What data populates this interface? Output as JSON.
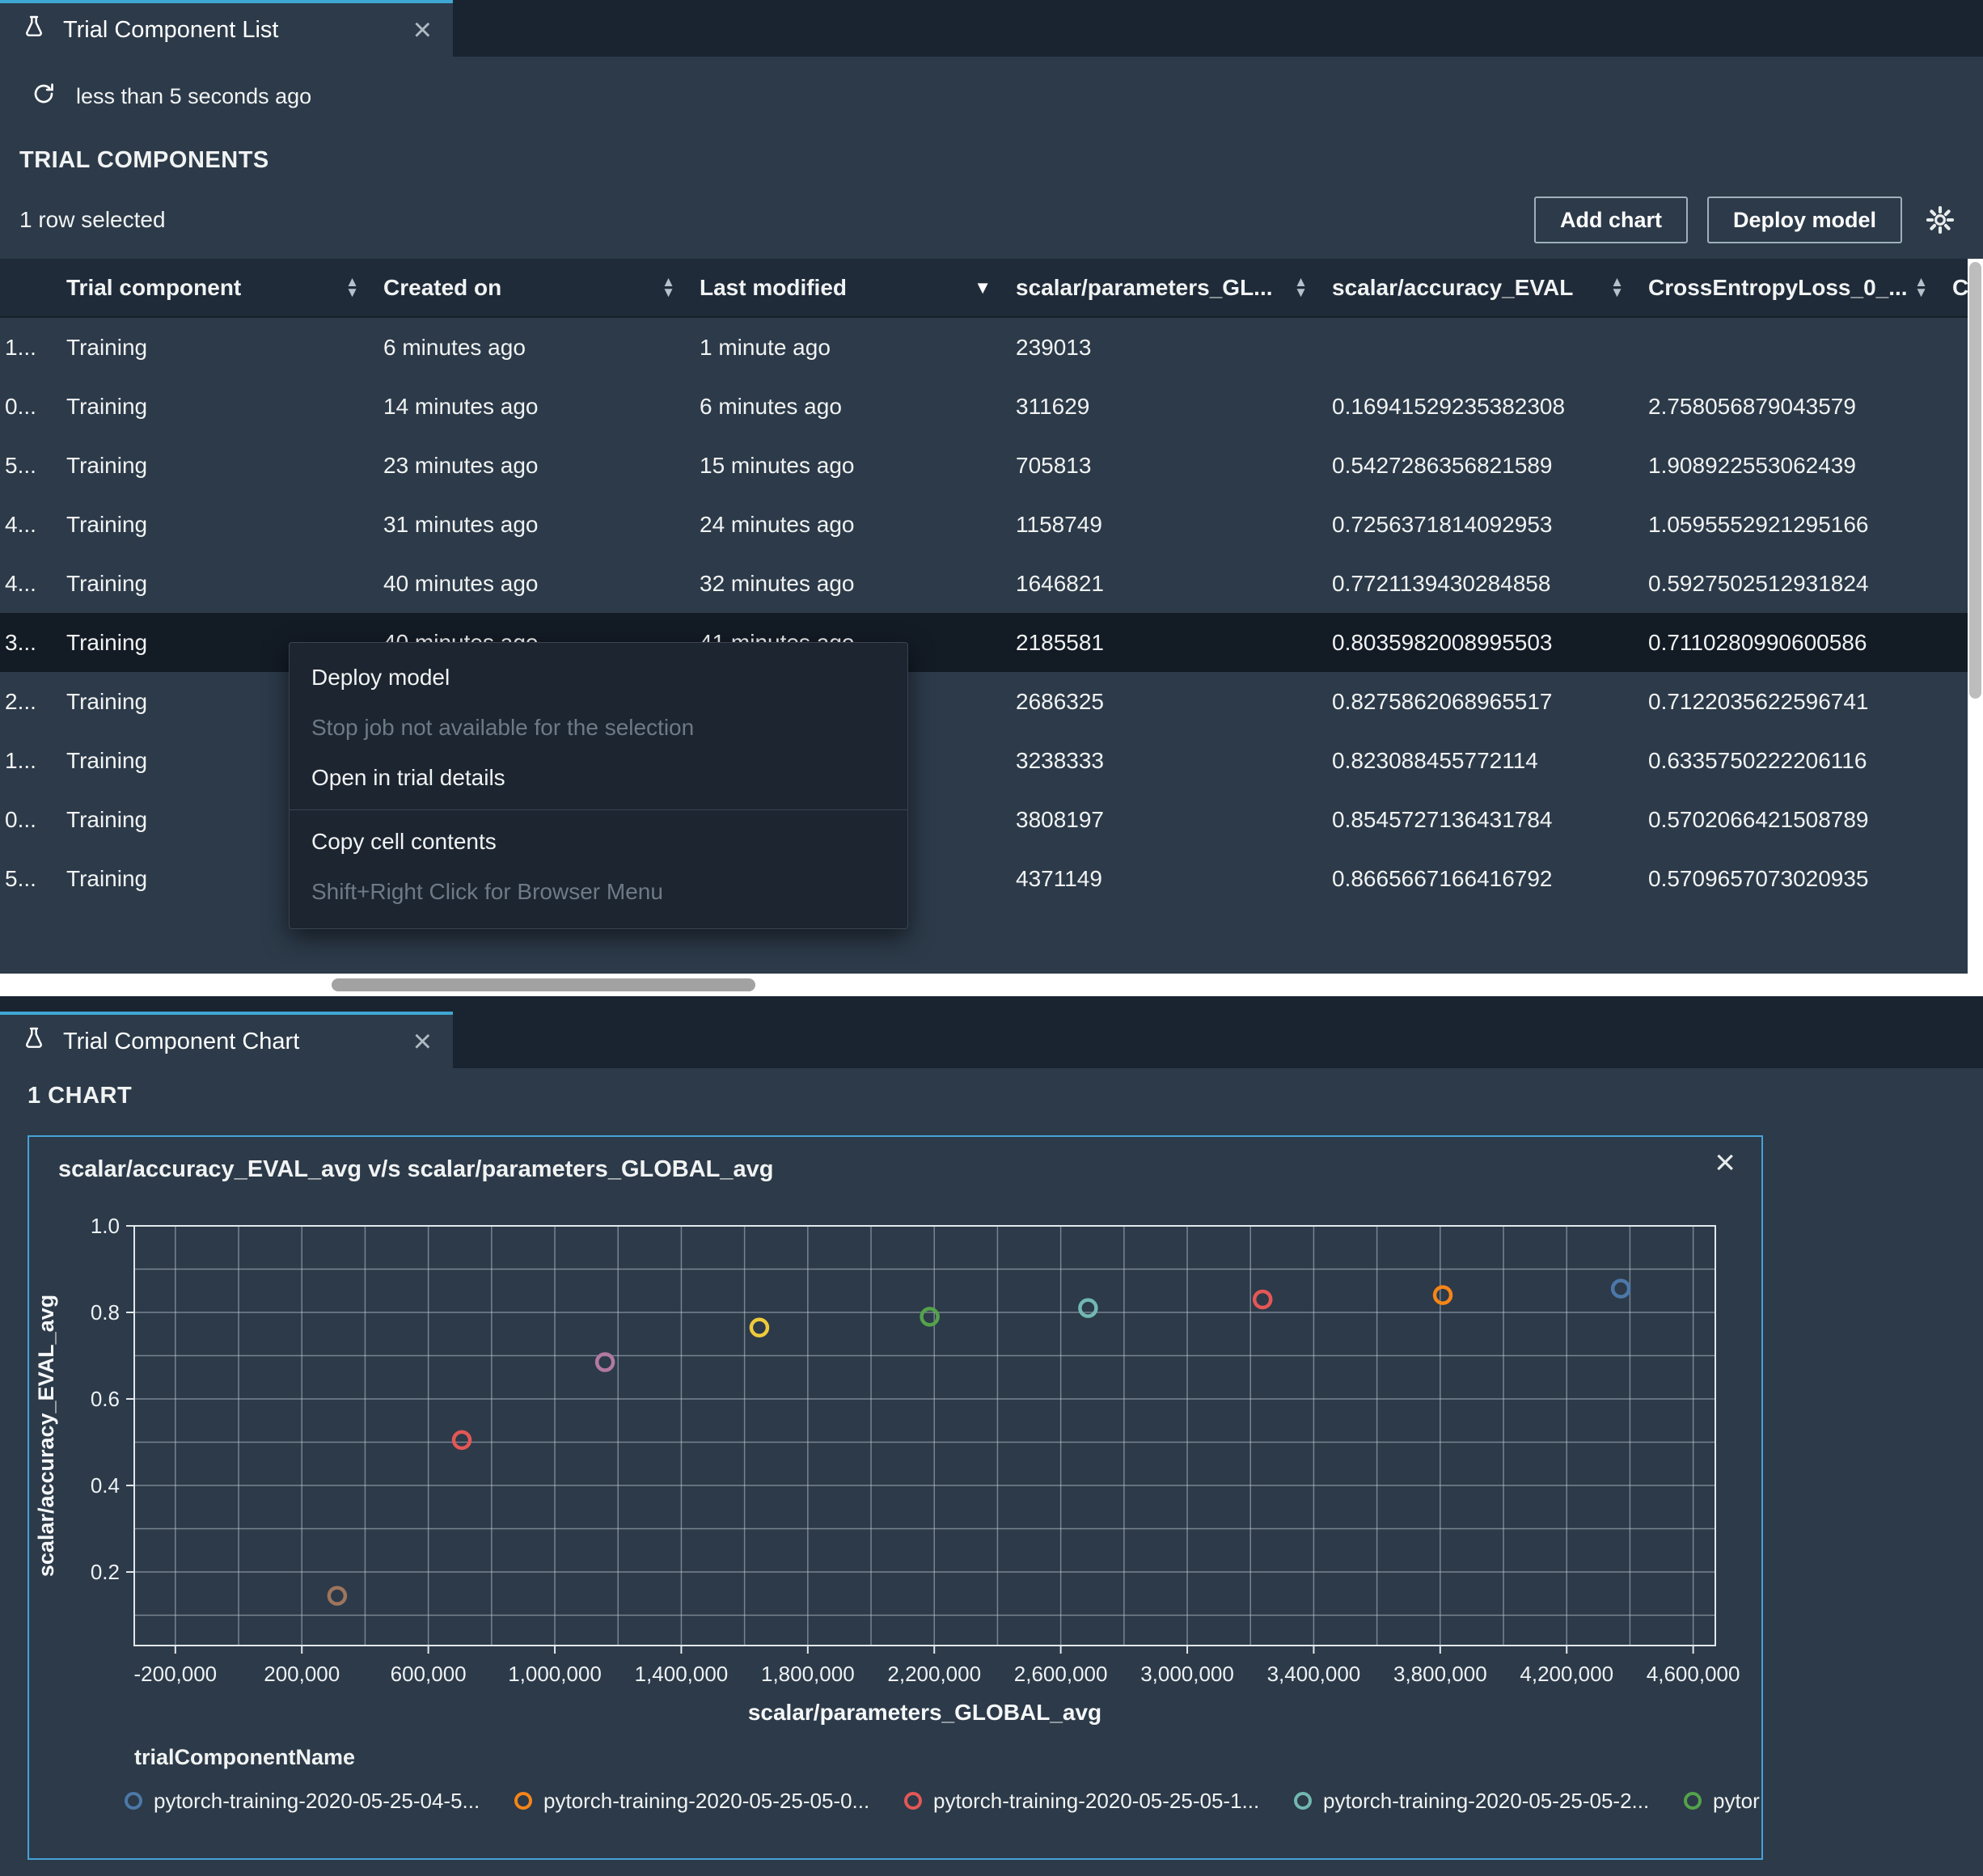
{
  "icons": {
    "close": "×",
    "sort_asc": "▲",
    "sort_desc": "▼"
  },
  "colors": {
    "accent": "#3fa7d4",
    "panel_bg": "#2c3a49",
    "chart_border": "#46a2d8",
    "selected_row": "#131b25"
  },
  "list_panel": {
    "tab_title": "Trial Component List",
    "refresh_text": "less than 5 seconds ago",
    "section_title": "TRIAL COMPONENTS",
    "selection_text": "1 row selected",
    "add_chart_label": "Add chart",
    "deploy_model_label": "Deploy model",
    "table": {
      "columns": [
        {
          "label": "",
          "sort": "none"
        },
        {
          "label": "Trial component",
          "sort": "both"
        },
        {
          "label": "Created on",
          "sort": "both"
        },
        {
          "label": "Last modified",
          "sort": "desc"
        },
        {
          "label": "scalar/parameters_GL...",
          "sort": "both"
        },
        {
          "label": "scalar/accuracy_EVAL",
          "sort": "both"
        },
        {
          "label": "CrossEntropyLoss_0_...",
          "sort": "both"
        },
        {
          "label": "C",
          "sort": "none"
        }
      ],
      "rows": [
        {
          "cells": [
            "1...",
            "Training",
            "6 minutes ago",
            "1 minute ago",
            "239013",
            "",
            "",
            ""
          ],
          "selected": false
        },
        {
          "cells": [
            "0...",
            "Training",
            "14 minutes ago",
            "6 minutes ago",
            "311629",
            "0.16941529235382308",
            "2.758056879043579",
            ""
          ],
          "selected": false
        },
        {
          "cells": [
            "5...",
            "Training",
            "23 minutes ago",
            "15 minutes ago",
            "705813",
            "0.5427286356821589",
            "1.908922553062439",
            ""
          ],
          "selected": false
        },
        {
          "cells": [
            "4...",
            "Training",
            "31 minutes ago",
            "24 minutes ago",
            "1158749",
            "0.7256371814092953",
            "1.0595552921295166",
            ""
          ],
          "selected": false
        },
        {
          "cells": [
            "4...",
            "Training",
            "40 minutes ago",
            "32 minutes ago",
            "1646821",
            "0.7721139430284858",
            "0.5927502512931824",
            ""
          ],
          "selected": false
        },
        {
          "cells": [
            "3...",
            "Training",
            "40 minutes ago",
            "41 minutes ago",
            "2185581",
            "0.8035982008995503",
            "0.7110280990600586",
            ""
          ],
          "selected": true
        },
        {
          "cells": [
            "2...",
            "Training",
            "",
            "",
            "2686325",
            "0.8275862068965517",
            "0.7122035622596741",
            ""
          ],
          "selected": false
        },
        {
          "cells": [
            "1...",
            "Training",
            "",
            "",
            "3238333",
            "0.823088455772114",
            "0.6335750222206116",
            ""
          ],
          "selected": false
        },
        {
          "cells": [
            "0...",
            "Training",
            "",
            "",
            "3808197",
            "0.8545727136431784",
            "0.5702066421508789",
            ""
          ],
          "selected": false
        },
        {
          "cells": [
            "5...",
            "Training",
            "",
            "",
            "4371149",
            "0.8665667166416792",
            "0.5709657073020935",
            ""
          ],
          "selected": false
        }
      ]
    },
    "context_menu": {
      "items": [
        {
          "label": "Deploy model",
          "disabled": false
        },
        {
          "label": "Stop job not available for the selection",
          "disabled": true
        },
        {
          "label": "Open in trial details",
          "disabled": false
        },
        {
          "separator": true
        },
        {
          "label": "Copy cell contents",
          "disabled": false
        },
        {
          "label": "Shift+Right Click for Browser Menu",
          "disabled": true
        }
      ]
    }
  },
  "chart_panel": {
    "tab_title": "Trial Component Chart",
    "section_title": "1 CHART"
  },
  "chart_data": {
    "type": "scatter",
    "title": "scalar/accuracy_EVAL_avg v/s scalar/parameters_GLOBAL_avg",
    "xlabel": "scalar/parameters_GLOBAL_avg",
    "ylabel": "scalar/accuracy_EVAL_avg",
    "xlim": [
      -330000,
      4670000
    ],
    "ylim": [
      0.03,
      1.0
    ],
    "x_tick_values": [
      -200000,
      200000,
      600000,
      1000000,
      1400000,
      1800000,
      2200000,
      2600000,
      3000000,
      3400000,
      3800000,
      4200000,
      4600000
    ],
    "y_tick_values": [
      0.2,
      0.4,
      0.6,
      0.8,
      1.0
    ],
    "x_grid_step": 200000,
    "y_grid_step": 0.1,
    "grid": true,
    "legend_position": "bottom",
    "legend_title": "trialComponentName",
    "legend_items": [
      {
        "label": "pytorch-training-2020-05-25-04-5...",
        "color": "#4c78a8"
      },
      {
        "label": "pytorch-training-2020-05-25-05-0...",
        "color": "#f58518"
      },
      {
        "label": "pytorch-training-2020-05-25-05-1...",
        "color": "#e45756"
      },
      {
        "label": "pytorch-training-2020-05-25-05-2...",
        "color": "#72b7b2"
      },
      {
        "label": "pytor",
        "color": "#54a24b"
      }
    ],
    "points": [
      {
        "x": 311629,
        "y": 0.145,
        "color": "#9d755d"
      },
      {
        "x": 705813,
        "y": 0.505,
        "color": "#e45756"
      },
      {
        "x": 1158749,
        "y": 0.685,
        "color": "#b279a2"
      },
      {
        "x": 1646821,
        "y": 0.765,
        "color": "#eeca3b"
      },
      {
        "x": 2185581,
        "y": 0.79,
        "color": "#54a24b"
      },
      {
        "x": 2686325,
        "y": 0.81,
        "color": "#72b7b2"
      },
      {
        "x": 3238333,
        "y": 0.83,
        "color": "#e45756"
      },
      {
        "x": 3808197,
        "y": 0.84,
        "color": "#f58518"
      },
      {
        "x": 4371149,
        "y": 0.855,
        "color": "#4c78a8"
      }
    ]
  }
}
